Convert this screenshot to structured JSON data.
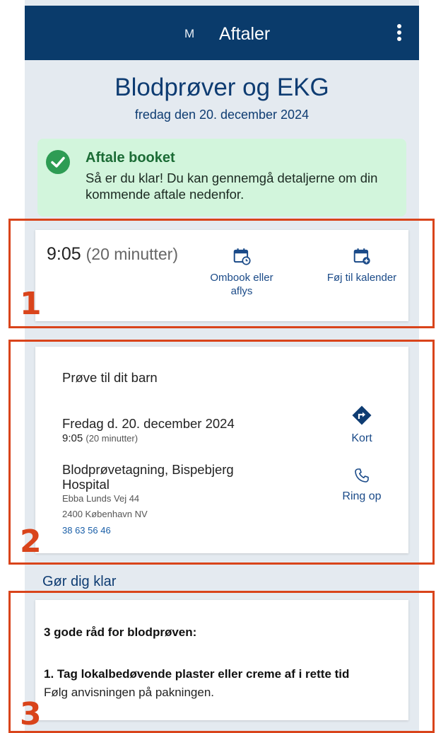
{
  "appbar": {
    "avatar_initial": "M",
    "title": "Aftaler"
  },
  "header": {
    "title": "Blodprøver og EKG",
    "date": "fredag den 20. december 2024"
  },
  "alert": {
    "title": "Aftale booket",
    "text": "Så er du klar! Du kan gennemgå detaljerne om din kommende aftale nedenfor."
  },
  "time_card": {
    "time": "9:05",
    "duration": "(20 minutter)",
    "rebook_label": "Ombook eller aflys",
    "calendar_label": "Føj til kalender"
  },
  "details": {
    "for_label": "Prøve til dit barn",
    "date_line": "Fredag d. 20. december 2024",
    "time": "9:05",
    "duration": "(20 minutter)",
    "location_name": "Blodprøvetagning, Bispebjerg Hospital",
    "address_line1": "Ebba Lunds Vej 44",
    "address_line2": "2400 København NV",
    "phone": "38 63 56 46",
    "map_label": "Kort",
    "call_label": "Ring op"
  },
  "prepare": {
    "section_title": "Gør dig klar",
    "heading": "3 gode råd for blodprøven:",
    "tip1_title": "1. Tag lokalbedøvende plaster eller creme af i rette tid",
    "tip1_text": "Følg anvisningen på pakningen."
  },
  "annotations": {
    "one": "1",
    "two": "2",
    "three": "3"
  },
  "colors": {
    "appbar": "#0a3b6b",
    "primary_text": "#0e3c72",
    "success_bg": "#d2f5dc",
    "success_icon": "#2e9c54",
    "annotation": "#d9441b",
    "map_icon": "#0e3c72"
  }
}
